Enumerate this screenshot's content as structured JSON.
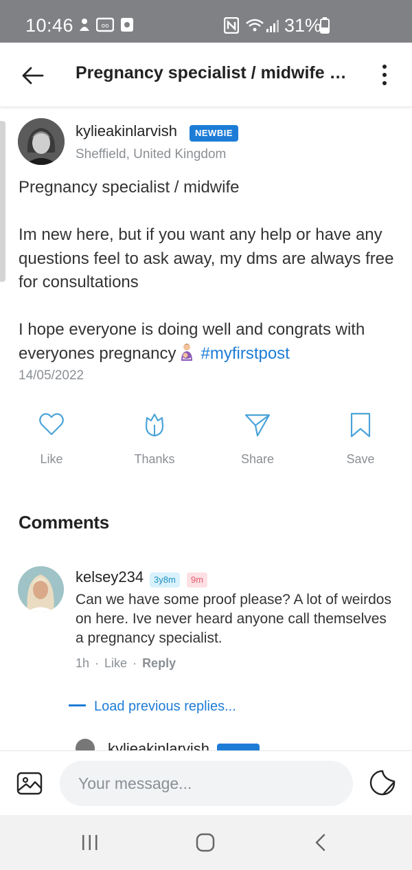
{
  "status_bar": {
    "time": "10:46",
    "battery": "31%"
  },
  "app_bar": {
    "title": "Pregnancy specialist / midwife  I..."
  },
  "post": {
    "author": "kylieakinlarvish",
    "badge": "NEWBIE",
    "location": "Sheffield, United Kingdom",
    "title_line": "Pregnancy specialist / midwife",
    "paragraph1": "Im new here, but if you want any help or have any questions feel to ask away, my dms are always free for consultations",
    "paragraph2": "I hope everyone is doing well and congrats with everyones pregnancy",
    "hashtag": "#myfirstpost",
    "date": "14/05/2022"
  },
  "actions": {
    "like": "Like",
    "thanks": "Thanks",
    "share": "Share",
    "save": "Save"
  },
  "comments": {
    "heading": "Comments",
    "items": [
      {
        "author": "kelsey234",
        "tag_child_age": "3y8m",
        "tag_pregnancy": "9m",
        "text": "Can we have some proof please? A lot of weirdos on here. Ive never heard anyone call themselves a pregnancy specialist.",
        "time": "1h",
        "like": "Like",
        "reply": "Reply"
      }
    ],
    "load_previous": "Load previous replies...",
    "reply_preview_author": "kylieakinlarvish"
  },
  "composer": {
    "placeholder": "Your message..."
  },
  "colors": {
    "accent": "#1d7cd6",
    "muted": "#8a8f94",
    "status_bar": "#7f8184"
  }
}
